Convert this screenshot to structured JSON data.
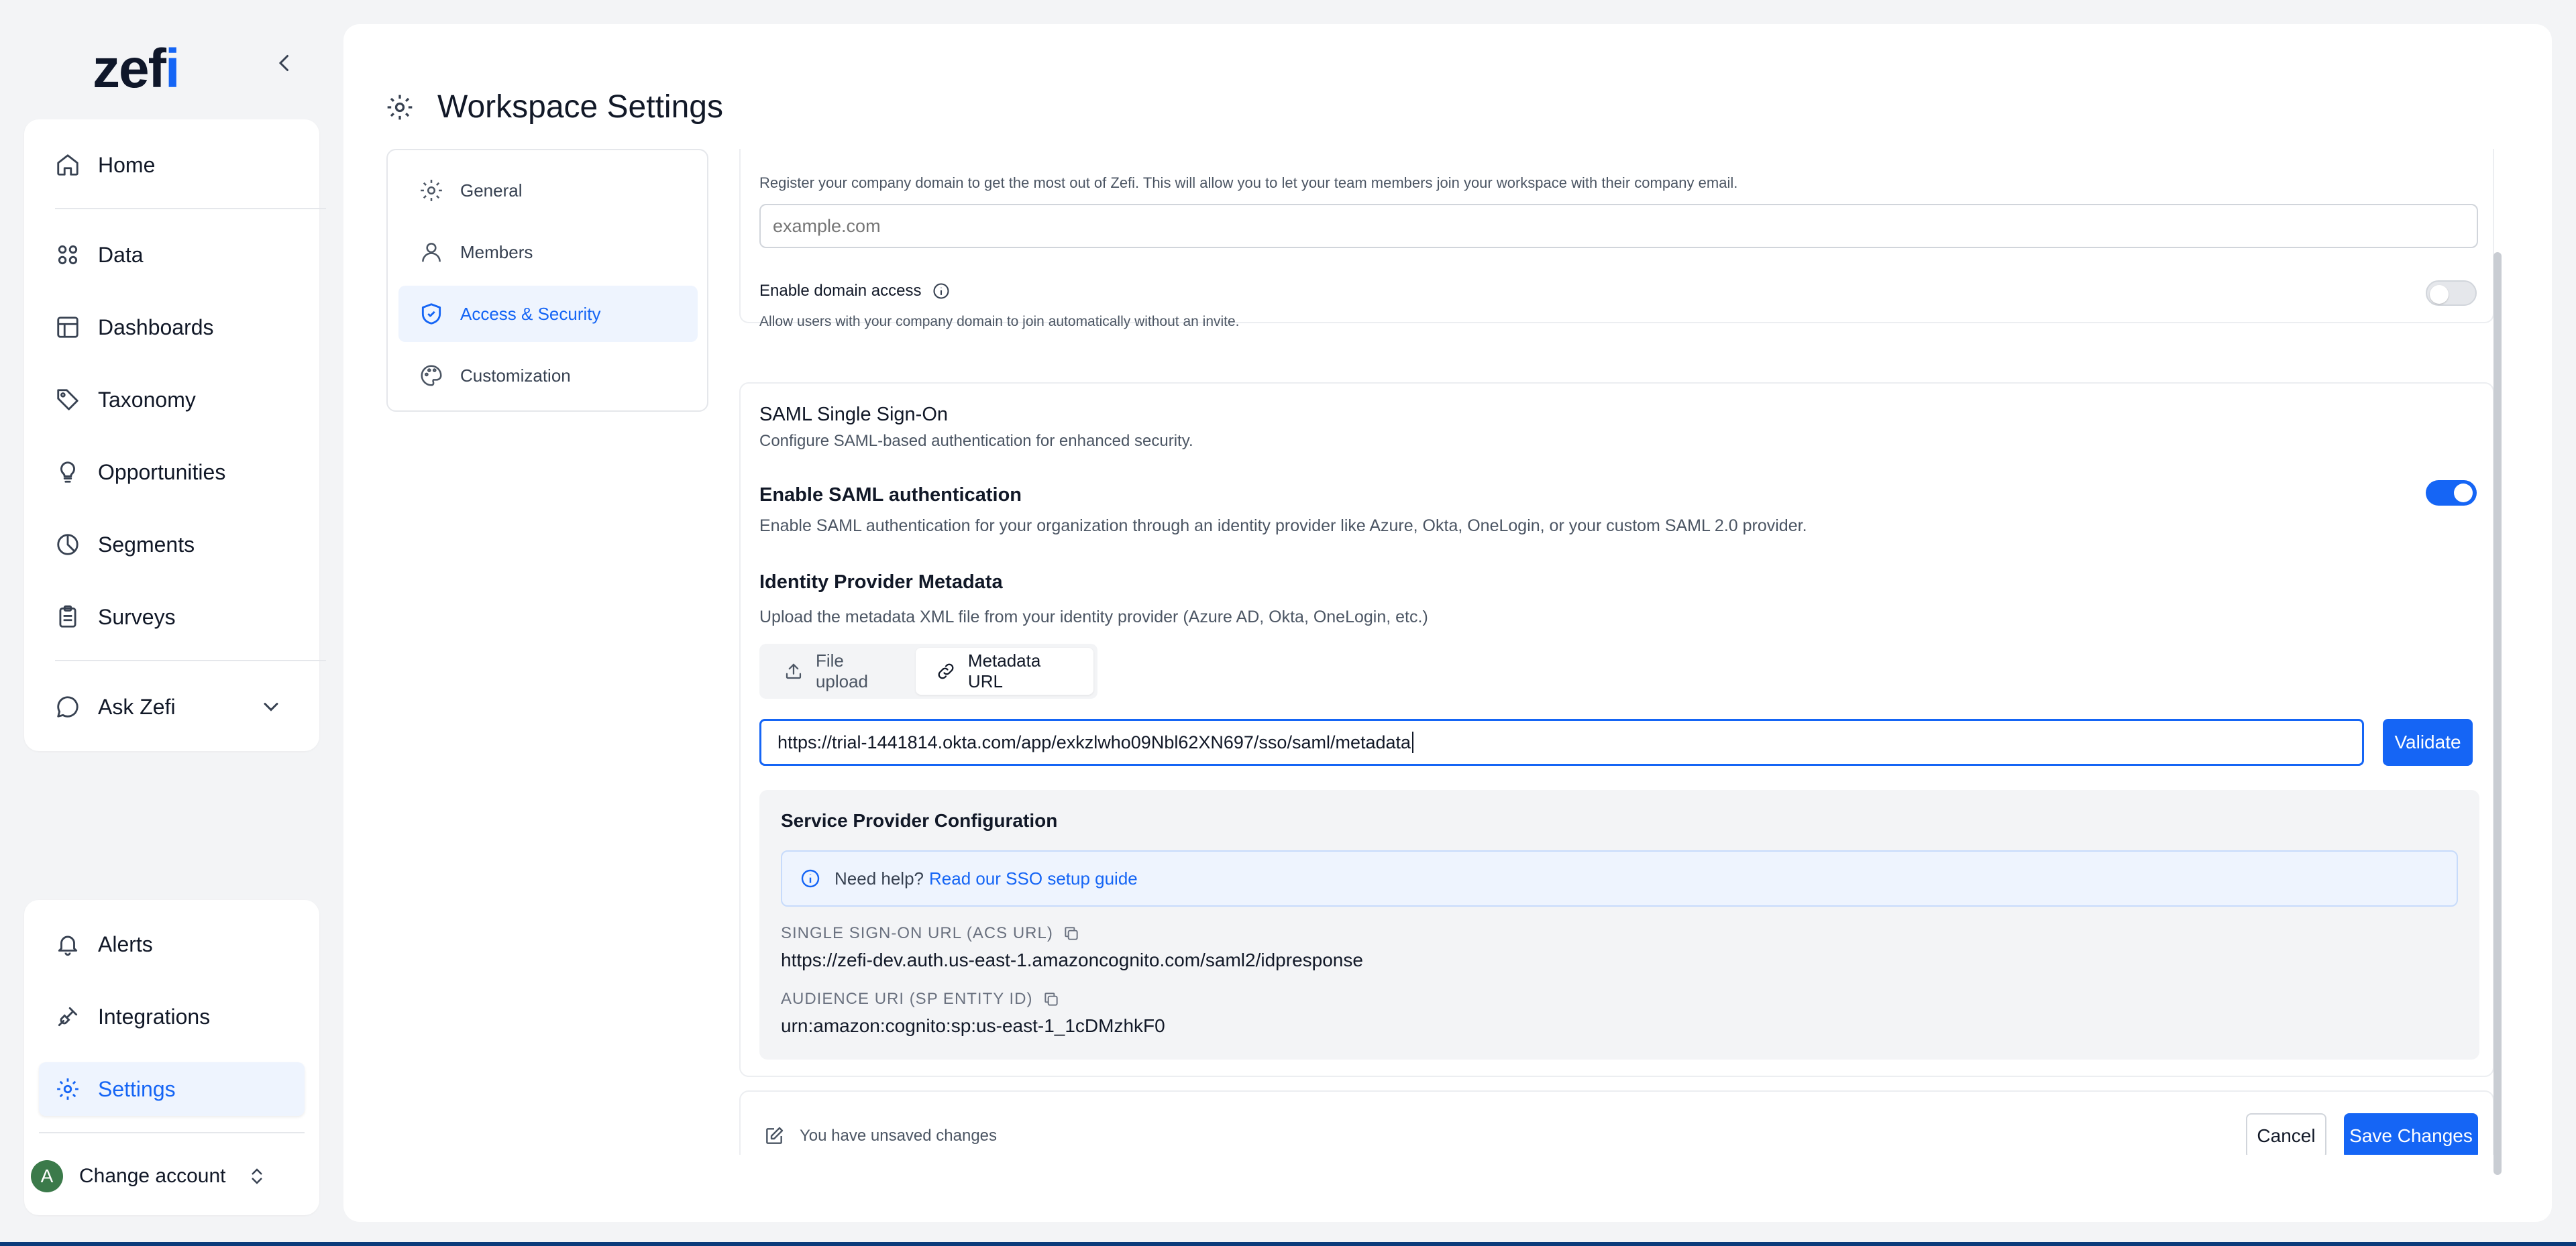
{
  "brand": {
    "logo_text": "zef",
    "logo_accent": "i",
    "accent_color": "#1565f5"
  },
  "sidebar": {
    "collapse_icon": "chevron-left-icon",
    "items": [
      {
        "label": "Home",
        "icon": "home-icon"
      },
      {
        "label": "Data",
        "icon": "data-icon"
      },
      {
        "label": "Dashboards",
        "icon": "dashboard-icon"
      },
      {
        "label": "Taxonomy",
        "icon": "tag-icon"
      },
      {
        "label": "Opportunities",
        "icon": "lightbulb-icon"
      },
      {
        "label": "Segments",
        "icon": "pie-chart-icon"
      },
      {
        "label": "Surveys",
        "icon": "clipboard-icon"
      },
      {
        "label": "Ask Zefi",
        "icon": "chat-icon"
      }
    ],
    "bottom_items": [
      {
        "label": "Alerts",
        "icon": "bell-icon"
      },
      {
        "label": "Integrations",
        "icon": "plug-icon"
      },
      {
        "label": "Settings",
        "icon": "gear-icon",
        "active": true
      }
    ],
    "account": {
      "avatar_letter": "A",
      "label": "Change account"
    }
  },
  "page": {
    "title": "Workspace Settings"
  },
  "settings_nav": [
    {
      "label": "General",
      "icon": "gear-icon"
    },
    {
      "label": "Members",
      "icon": "user-icon"
    },
    {
      "label": "Access & Security",
      "icon": "shield-icon",
      "active": true
    },
    {
      "label": "Customization",
      "icon": "palette-icon"
    }
  ],
  "domain": {
    "help_text": "Register your company domain to get the most out of Zefi. This will allow you to let your team members join your workspace with their company email.",
    "placeholder": "example.com",
    "enable_label": "Enable domain access",
    "enable_help": "Allow users with your company domain to join automatically without an invite.",
    "enabled": false
  },
  "saml": {
    "title": "SAML Single Sign-On",
    "description": "Configure SAML-based authentication for enhanced security.",
    "enable_label": "Enable SAML authentication",
    "enable_description": "Enable SAML authentication for your organization through an identity provider like Azure, Okta, OneLogin, or your custom SAML 2.0 provider.",
    "enabled": true,
    "metadata_title": "Identity Provider Metadata",
    "metadata_description": "Upload the metadata XML file from your identity provider (Azure AD, Okta, OneLogin, etc.)",
    "tabs": [
      {
        "label": "File upload",
        "icon": "upload-icon"
      },
      {
        "label": "Metadata URL",
        "icon": "link-icon",
        "active": true
      }
    ],
    "metadata_url": "https://trial-1441814.okta.com/app/exkzlwho09Nbl62XN697/sso/saml/metadata",
    "validate_label": "Validate"
  },
  "service_provider": {
    "title": "Service Provider Configuration",
    "help_prefix": "Need help?",
    "help_link": "Read our SSO setup guide",
    "acs_label": "SINGLE SIGN-ON URL (ACS URL)",
    "acs_value": "https://zefi-dev.auth.us-east-1.amazoncognito.com/saml2/idpresponse",
    "audience_label": "AUDIENCE URI (SP ENTITY ID)",
    "audience_value": "urn:amazon:cognito:sp:us-east-1_1cDMzhkF0"
  },
  "footer": {
    "unsaved_text": "You have unsaved changes",
    "cancel_label": "Cancel",
    "save_label": "Save Changes"
  }
}
